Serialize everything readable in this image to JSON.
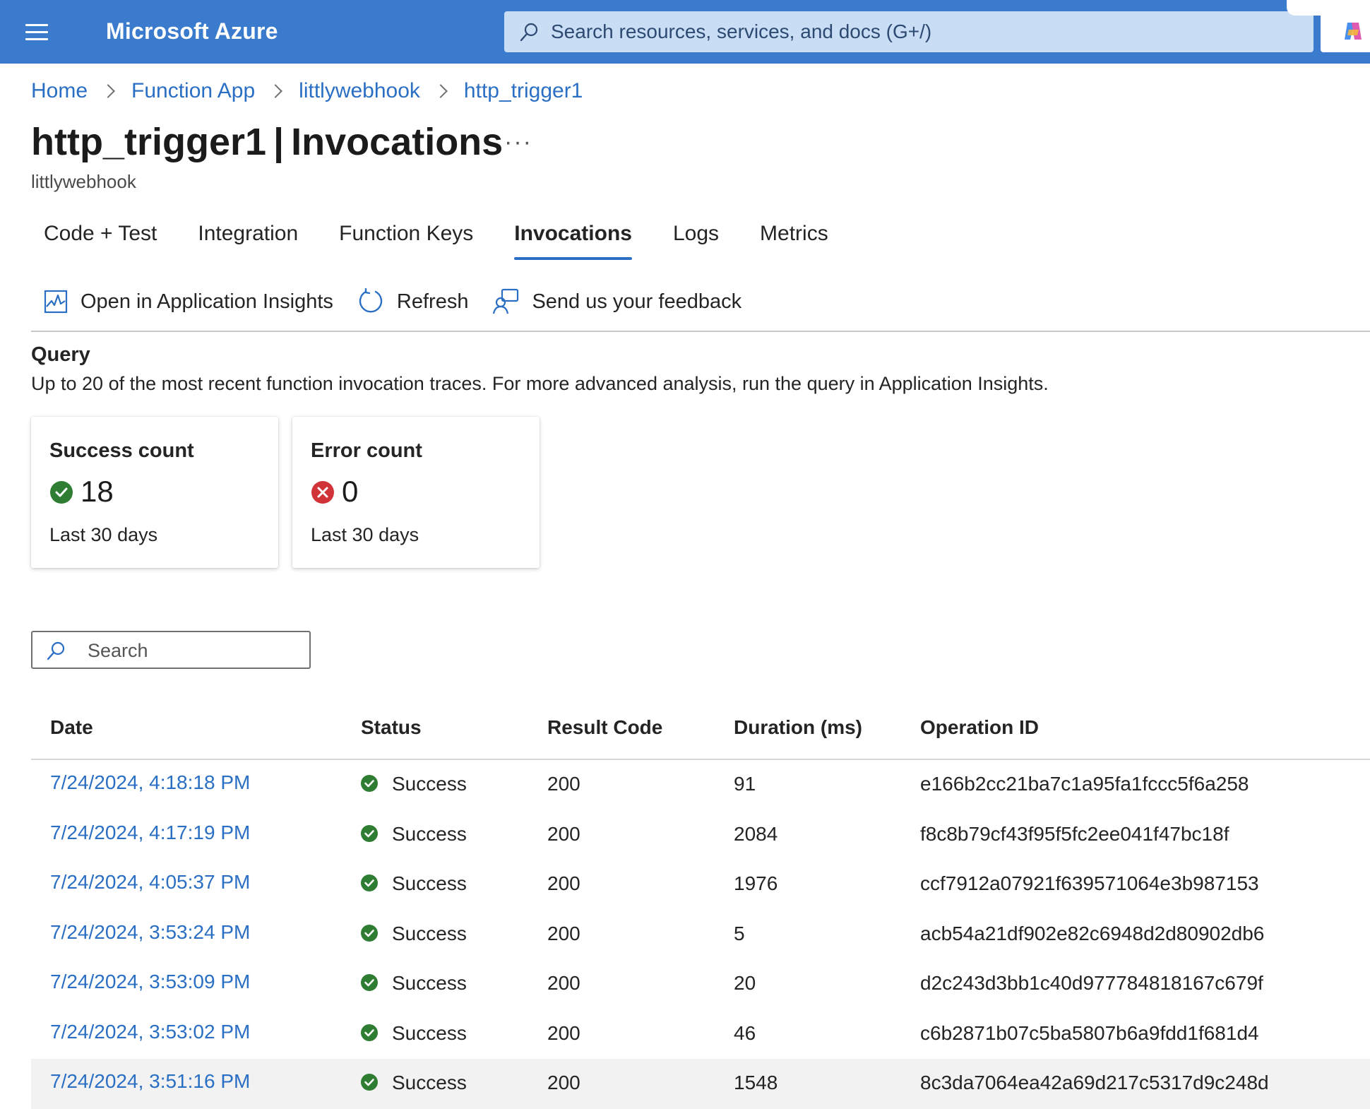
{
  "topbar": {
    "brand": "Microsoft Azure",
    "search_placeholder": "Search resources, services, and docs (G+/)"
  },
  "breadcrumb": [
    "Home",
    "Function App",
    "littlywebhook",
    "http_trigger1"
  ],
  "header": {
    "title_bold": "http_trigger1",
    "title_separator": "|",
    "title_rest": "Invocations",
    "more": "···",
    "subtitle": "littlywebhook"
  },
  "tabs": [
    {
      "label": "Code + Test",
      "active": false
    },
    {
      "label": "Integration",
      "active": false
    },
    {
      "label": "Function Keys",
      "active": false
    },
    {
      "label": "Invocations",
      "active": true
    },
    {
      "label": "Logs",
      "active": false
    },
    {
      "label": "Metrics",
      "active": false
    }
  ],
  "toolbar": {
    "open_insights": "Open in Application Insights",
    "refresh": "Refresh",
    "feedback": "Send us your feedback"
  },
  "query": {
    "title": "Query",
    "description": "Up to 20 of the most recent function invocation traces. For more advanced analysis, run the query in Application Insights."
  },
  "cards": {
    "success": {
      "title": "Success count",
      "value": "18",
      "sub": "Last 30 days"
    },
    "error": {
      "title": "Error count",
      "value": "0",
      "sub": "Last 30 days"
    }
  },
  "search": {
    "placeholder": "Search",
    "value": ""
  },
  "table": {
    "columns": {
      "date": "Date",
      "status": "Status",
      "result_code": "Result Code",
      "duration": "Duration (ms)",
      "operation_id": "Operation ID"
    },
    "rows": [
      {
        "date": "7/24/2024, 4:18:18 PM",
        "status": "Success",
        "code": "200",
        "duration": "91",
        "op": "e166b2cc21ba7c1a95fa1fccc5f6a258"
      },
      {
        "date": "7/24/2024, 4:17:19 PM",
        "status": "Success",
        "code": "200",
        "duration": "2084",
        "op": "f8c8b79cf43f95f5fc2ee041f47bc18f"
      },
      {
        "date": "7/24/2024, 4:05:37 PM",
        "status": "Success",
        "code": "200",
        "duration": "1976",
        "op": "ccf7912a07921f639571064e3b987153"
      },
      {
        "date": "7/24/2024, 3:53:24 PM",
        "status": "Success",
        "code": "200",
        "duration": "5",
        "op": "acb54a21df902e82c6948d2d80902db6"
      },
      {
        "date": "7/24/2024, 3:53:09 PM",
        "status": "Success",
        "code": "200",
        "duration": "20",
        "op": "d2c243d3bb1c40d977784818167c679f"
      },
      {
        "date": "7/24/2024, 3:53:02 PM",
        "status": "Success",
        "code": "200",
        "duration": "46",
        "op": "c6b2871b07c5ba5807b6a9fdd1f681d4"
      },
      {
        "date": "7/24/2024, 3:51:16 PM",
        "status": "Success",
        "code": "200",
        "duration": "1548",
        "op": "8c3da7064ea42a69d217c5317d9c248d"
      }
    ]
  },
  "colors": {
    "topbar": "#3a7bcd",
    "link": "#2a6fc4",
    "success": "#2e7d32",
    "error": "#d13438"
  }
}
